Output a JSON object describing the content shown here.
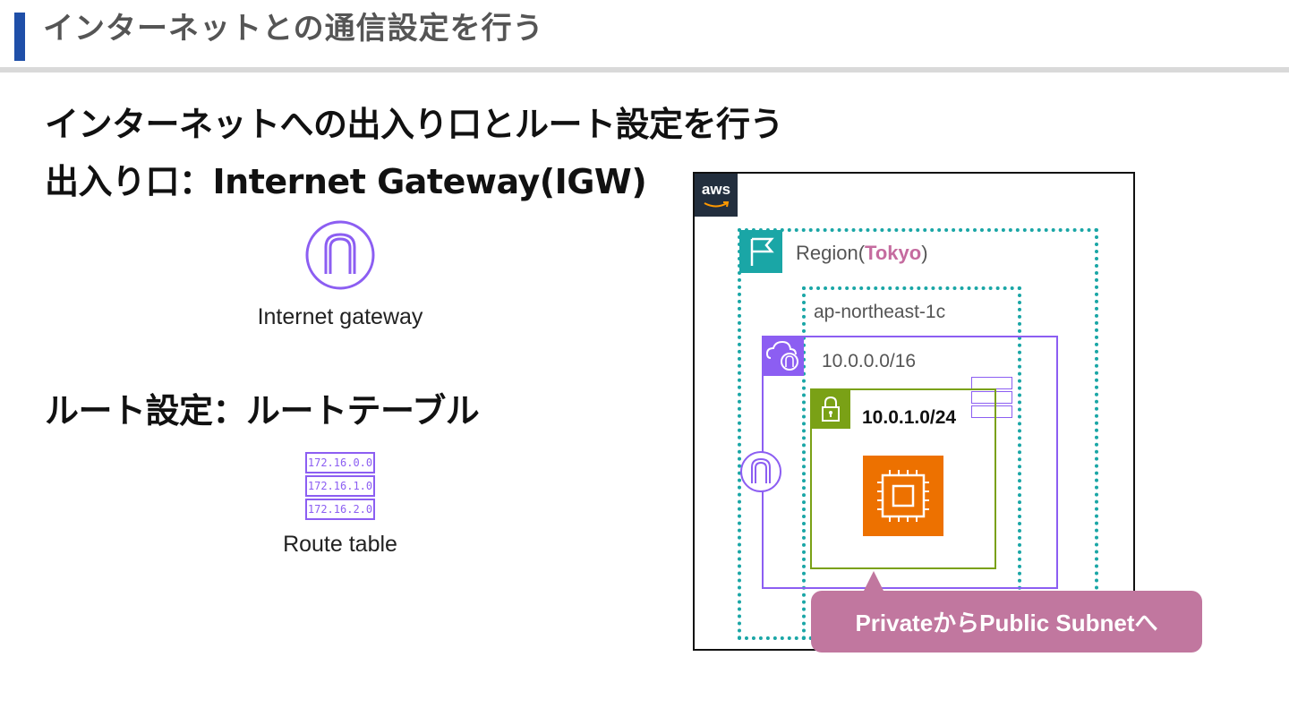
{
  "header": {
    "title": "インターネットとの通信設定を行う",
    "accent_color": "#1f4fa8"
  },
  "content": {
    "heading_main": "インターネットへの出入り口とルート設定を行う",
    "heading_gateway": "出入り口：Internet Gateway(IGW)",
    "heading_route": "ルート設定：ルートテーブル",
    "igw_caption": "Internet gateway",
    "route_table_caption": "Route table",
    "route_table_entries": [
      "172.16.0.0",
      "172.16.1.0",
      "172.16.2.0"
    ]
  },
  "diagram": {
    "aws_logo_text": "aws",
    "region_label_prefix": "Region(",
    "region_name": "Tokyo",
    "region_label_suffix": ")",
    "az_label": "ap-northeast-1c",
    "vpc_cidr": "10.0.0.0/16",
    "subnet_cidr": "10.0.1.0/24",
    "callout_text": "PrivateからPublic Subnetへ",
    "icons": [
      "aws-logo",
      "region-flag-icon",
      "vpc-cloud-icon",
      "subnet-lock-icon",
      "ec2-instance-icon",
      "internet-gateway-icon",
      "route-table-icon"
    ],
    "colors": {
      "region": "#1aa6a6",
      "vpc": "#8c5ef2",
      "subnet": "#7aa116",
      "ec2": "#ed7100",
      "callout": "#c1779f",
      "region_highlight": "#c56b9f"
    }
  }
}
